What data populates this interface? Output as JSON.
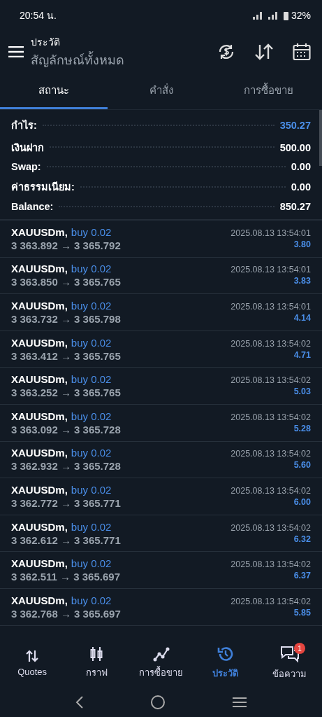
{
  "status_bar": {
    "time": "20:54 น.",
    "battery": "32%"
  },
  "header": {
    "subtitle": "ประวัติ",
    "title": "สัญลักษณ์ทั้งหมด"
  },
  "tabs": [
    {
      "label": "สถานะ",
      "selected": true
    },
    {
      "label": "คำสั่ง",
      "selected": false
    },
    {
      "label": "การซื้อขาย",
      "selected": false
    }
  ],
  "summary": [
    {
      "label": "กำไร:",
      "value": "350.27",
      "highlight": true
    },
    {
      "label": "เงินฝาก",
      "value": "500.00",
      "highlight": false
    },
    {
      "label": "Swap:",
      "value": "0.00",
      "highlight": false
    },
    {
      "label": "ค่าธรรมเนียม:",
      "value": "0.00",
      "highlight": false
    },
    {
      "label": "Balance:",
      "value": "850.27",
      "highlight": false
    }
  ],
  "deals": [
    {
      "symbol": "XAUUSDm,",
      "side": "buy 0.02",
      "time": "2025.08.13 13:54:01",
      "prices": "3 363.892 → 3 365.792",
      "profit": "3.80"
    },
    {
      "symbol": "XAUUSDm,",
      "side": "buy 0.02",
      "time": "2025.08.13 13:54:01",
      "prices": "3 363.850 → 3 365.765",
      "profit": "3.83"
    },
    {
      "symbol": "XAUUSDm,",
      "side": "buy 0.02",
      "time": "2025.08.13 13:54:01",
      "prices": "3 363.732 → 3 365.798",
      "profit": "4.14"
    },
    {
      "symbol": "XAUUSDm,",
      "side": "buy 0.02",
      "time": "2025.08.13 13:54:02",
      "prices": "3 363.412 → 3 365.765",
      "profit": "4.71"
    },
    {
      "symbol": "XAUUSDm,",
      "side": "buy 0.02",
      "time": "2025.08.13 13:54:02",
      "prices": "3 363.252 → 3 365.765",
      "profit": "5.03"
    },
    {
      "symbol": "XAUUSDm,",
      "side": "buy 0.02",
      "time": "2025.08.13 13:54:02",
      "prices": "3 363.092 → 3 365.728",
      "profit": "5.28"
    },
    {
      "symbol": "XAUUSDm,",
      "side": "buy 0.02",
      "time": "2025.08.13 13:54:02",
      "prices": "3 362.932 → 3 365.728",
      "profit": "5.60"
    },
    {
      "symbol": "XAUUSDm,",
      "side": "buy 0.02",
      "time": "2025.08.13 13:54:02",
      "prices": "3 362.772 → 3 365.771",
      "profit": "6.00"
    },
    {
      "symbol": "XAUUSDm,",
      "side": "buy 0.02",
      "time": "2025.08.13 13:54:02",
      "prices": "3 362.612 → 3 365.771",
      "profit": "6.32"
    },
    {
      "symbol": "XAUUSDm,",
      "side": "buy 0.02",
      "time": "2025.08.13 13:54:02",
      "prices": "3 362.511 → 3 365.697",
      "profit": "6.37"
    },
    {
      "symbol": "XAUUSDm,",
      "side": "buy 0.02",
      "time": "2025.08.13 13:54:02",
      "prices": "3 362.768 → 3 365.697",
      "profit": "5.85"
    }
  ],
  "bottom_nav": [
    {
      "kind": "quotes",
      "label": "Quotes",
      "selected": false
    },
    {
      "kind": "chart",
      "label": "กราฟ",
      "selected": false
    },
    {
      "kind": "trade",
      "label": "การซื้อขาย",
      "selected": false
    },
    {
      "kind": "history",
      "label": "ประวัติ",
      "selected": true
    },
    {
      "kind": "messages",
      "label": "ข้อความ",
      "selected": false,
      "badge": "1"
    }
  ]
}
